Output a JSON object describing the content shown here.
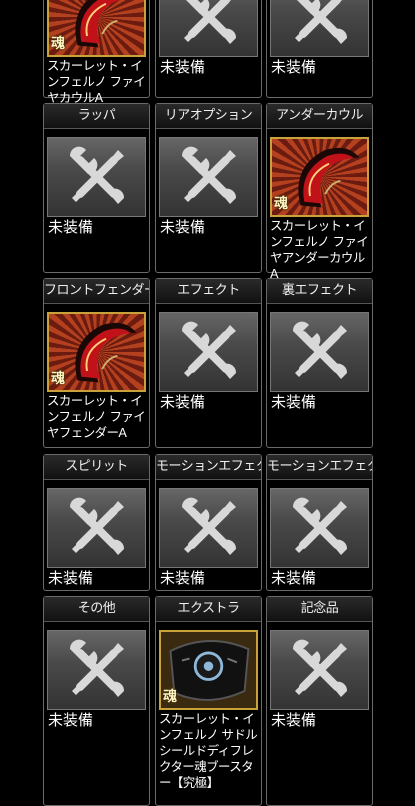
{
  "rows": [
    {
      "slots": [
        {
          "title": "",
          "state": "item",
          "item_name": "スカーレット・インフェルノ ファイヤカウルA",
          "art": "cowl"
        },
        {
          "title": "",
          "state": "empty",
          "status": "未装備"
        },
        {
          "title": "",
          "state": "empty",
          "status": "未装備"
        }
      ]
    },
    {
      "slots": [
        {
          "title": "ラッパ",
          "state": "empty",
          "status": "未装備"
        },
        {
          "title": "リアオプション",
          "state": "empty",
          "status": "未装備"
        },
        {
          "title": "アンダーカウル",
          "state": "item",
          "item_name": "スカーレット・インフェルノ ファイヤアンダーカウルA",
          "art": "undercowl"
        }
      ]
    },
    {
      "slots": [
        {
          "title": "フロントフェンダー",
          "state": "item",
          "item_name": "スカーレット・インフェルノ ファイヤフェンダーA",
          "art": "fender"
        },
        {
          "title": "エフェクト",
          "state": "empty",
          "status": "未装備"
        },
        {
          "title": "裏エフェクト",
          "state": "empty",
          "status": "未装備"
        }
      ]
    },
    {
      "slots": [
        {
          "title": "スピリット",
          "state": "empty",
          "status": "未装備"
        },
        {
          "title": "モーションエフェクト",
          "state": "empty",
          "status": "未装備"
        },
        {
          "title": "モーションエフェクトII",
          "state": "empty",
          "status": "未装備"
        }
      ]
    },
    {
      "slots": [
        {
          "title": "その他",
          "state": "empty",
          "status": "未装備"
        },
        {
          "title": "エクストラ",
          "state": "item",
          "item_name": "スカーレット・インフェルノ サドルシールドディフレクター魂ブースター【究極】",
          "art": "saddle"
        },
        {
          "title": "記念品",
          "state": "empty",
          "status": "未装備"
        }
      ]
    }
  ],
  "badge_text": "魂",
  "colors": {
    "background": "#000000",
    "card_border": "#6a6a6a",
    "item_frame": "#c9a23a",
    "wrench": "#d8d8d8"
  },
  "icons": {
    "empty": "wrench-screwdriver-icon"
  }
}
